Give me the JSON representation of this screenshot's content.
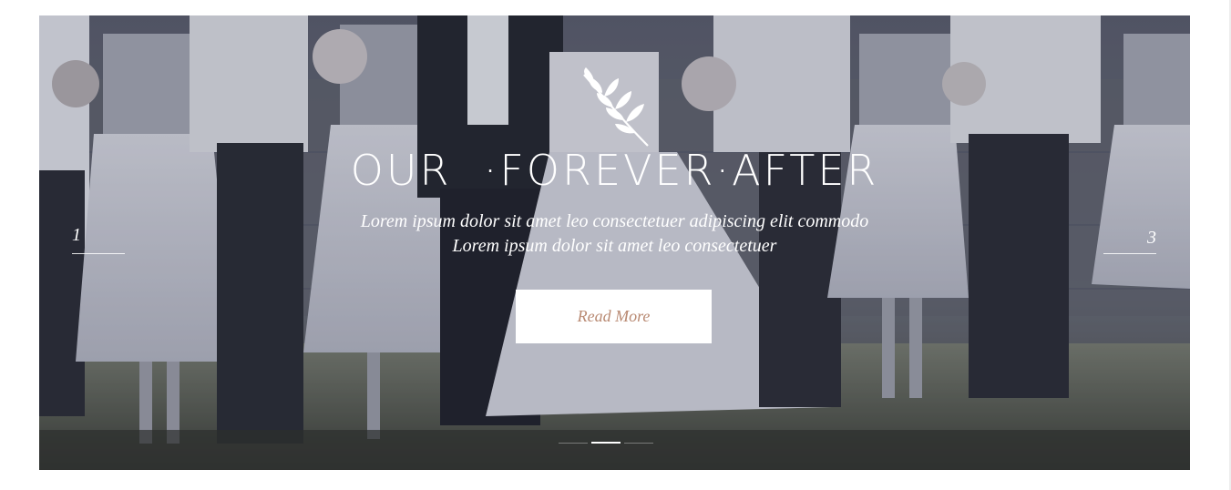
{
  "hero": {
    "title": "OUR  ·FOREVER·AFTER",
    "subtitle_line1": "Lorem ipsum dolor sit amet leo consectetuer adipiscing elit commodo",
    "subtitle_line2": "Lorem ipsum dolor sit amet leo consectetuer",
    "button_label": "Read More",
    "emblem_icon": "olive-branch-icon"
  },
  "slider": {
    "prev_number": "1",
    "next_number": "3",
    "dot_count": 3,
    "active_dot_index": 1
  },
  "colors": {
    "button_text": "#b98a73",
    "overlay": "#1e2034"
  }
}
